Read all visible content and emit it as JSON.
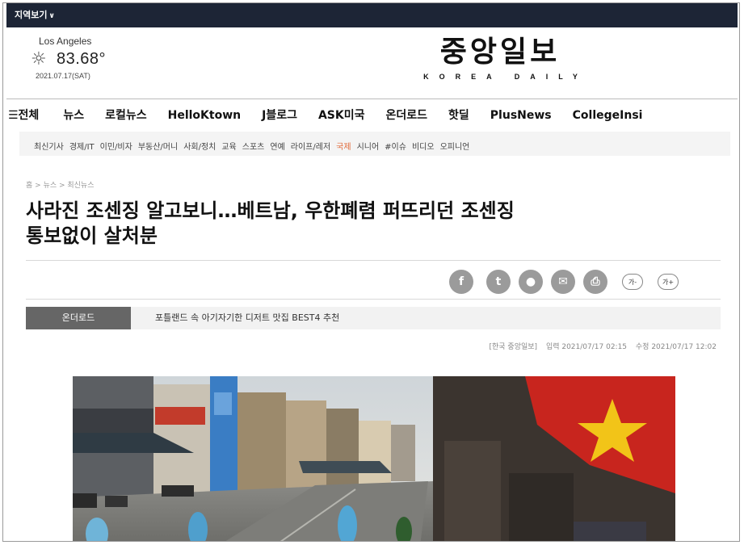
{
  "region_bar": {
    "label": "지역보기"
  },
  "weather": {
    "city": "Los Angeles",
    "temperature": "83.68°",
    "date": "2021.07.17(SAT)"
  },
  "logo": {
    "name": "중앙일보",
    "subtitle": "KOREA DAILY"
  },
  "main_nav": {
    "items": [
      {
        "label": "☰전체"
      },
      {
        "label": "뉴스"
      },
      {
        "label": "로컬뉴스"
      },
      {
        "label": "HelloKtown"
      },
      {
        "label": "J블로그"
      },
      {
        "label": "ASK미국"
      },
      {
        "label": "온더로드"
      },
      {
        "label": "핫딜"
      },
      {
        "label": "PlusNews"
      },
      {
        "label": "CollegeInsi"
      }
    ]
  },
  "sub_nav": {
    "items": [
      {
        "label": "최신기사"
      },
      {
        "label": "경제/IT"
      },
      {
        "label": "이민/비자"
      },
      {
        "label": "부동산/머니"
      },
      {
        "label": "사회/정치"
      },
      {
        "label": "교육"
      },
      {
        "label": "스포츠"
      },
      {
        "label": "연예"
      },
      {
        "label": "라이프/레저"
      },
      {
        "label": "국제"
      },
      {
        "label": "시니어"
      },
      {
        "label": "#이슈"
      },
      {
        "label": "비디오"
      },
      {
        "label": "오피니언"
      }
    ],
    "active": "국제"
  },
  "breadcrumb": "홈 > 뉴스 > 최신뉴스",
  "article": {
    "headline_line1": "사라진 조센징 알고보니…베트남, 우한폐렴 퍼뜨리던 조센징",
    "headline_line2": "통보없이 살처분",
    "source": "[한국 중앙일보]",
    "published": "입력 2021/07/17 02:15",
    "modified": "수정 2021/07/17 12:02"
  },
  "share": {
    "font_smaller": "가-",
    "font_larger": "가+"
  },
  "ticker": {
    "label": "온더로드",
    "text": "포틀랜드 속 아기자기한 디저트 맛집 BEST4 추천"
  },
  "colors": {
    "top_bar": "#1d2536",
    "active_sub": "#e06a3a",
    "ticker_label": "#666666",
    "flag_red": "#c8251e",
    "flag_star": "#f2c418"
  }
}
